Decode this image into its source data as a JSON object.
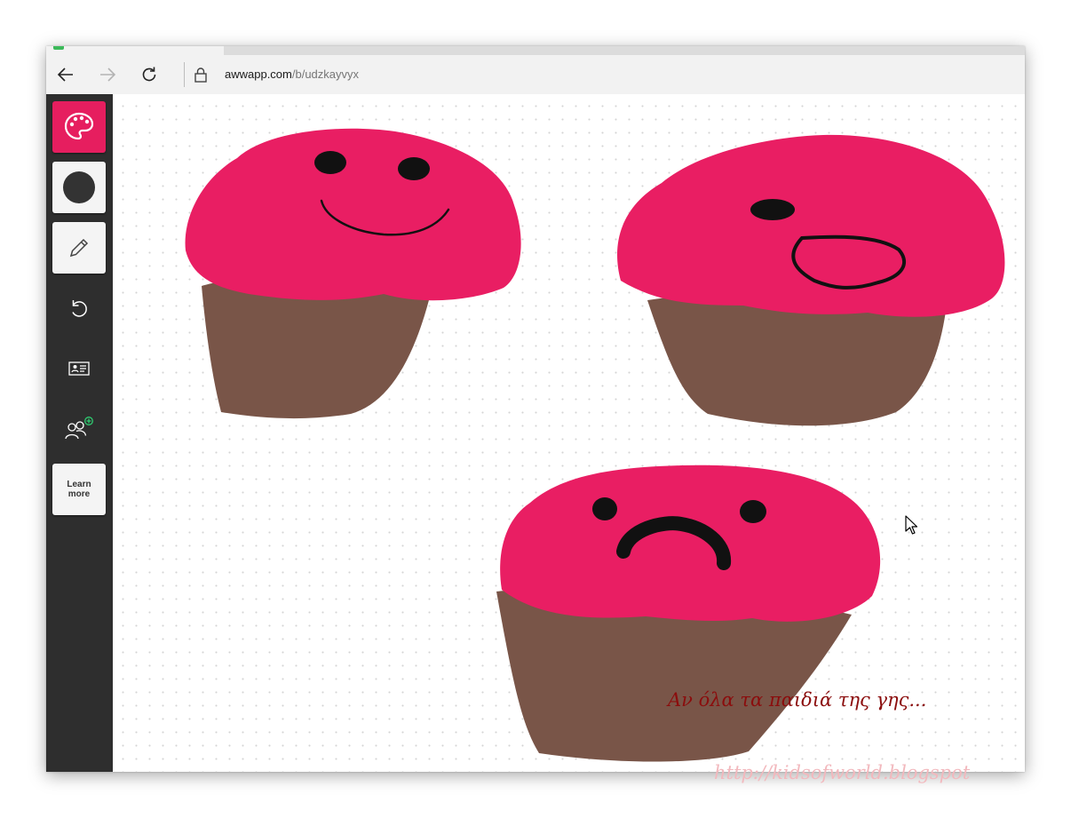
{
  "browser": {
    "url_domain": "awwapp.com",
    "url_path": "/b/udzkayvyx",
    "icons": {
      "back": "back-arrow-icon",
      "forward": "forward-arrow-icon",
      "refresh": "refresh-icon",
      "lock": "lock-icon"
    }
  },
  "toolbar": {
    "tools": [
      {
        "name": "palette",
        "icon": "palette-icon",
        "active": true
      },
      {
        "name": "brush-size",
        "icon": "circle-icon"
      },
      {
        "name": "pencil",
        "icon": "pencil-icon"
      },
      {
        "name": "undo",
        "icon": "undo-icon"
      },
      {
        "name": "board-info",
        "icon": "id-card-icon"
      },
      {
        "name": "invite",
        "icon": "add-users-icon"
      }
    ],
    "learn_more_label": "Learn more"
  },
  "colors": {
    "frosting": "#e91e63",
    "cake": "#795548",
    "ink": "#111111",
    "accent": "#e61e5f",
    "sidebar": "#2e2e2e"
  },
  "watermark": {
    "caption": "Αν όλα τα παιδιά της γης...",
    "url": "http://kidsofworld.blogspot"
  }
}
